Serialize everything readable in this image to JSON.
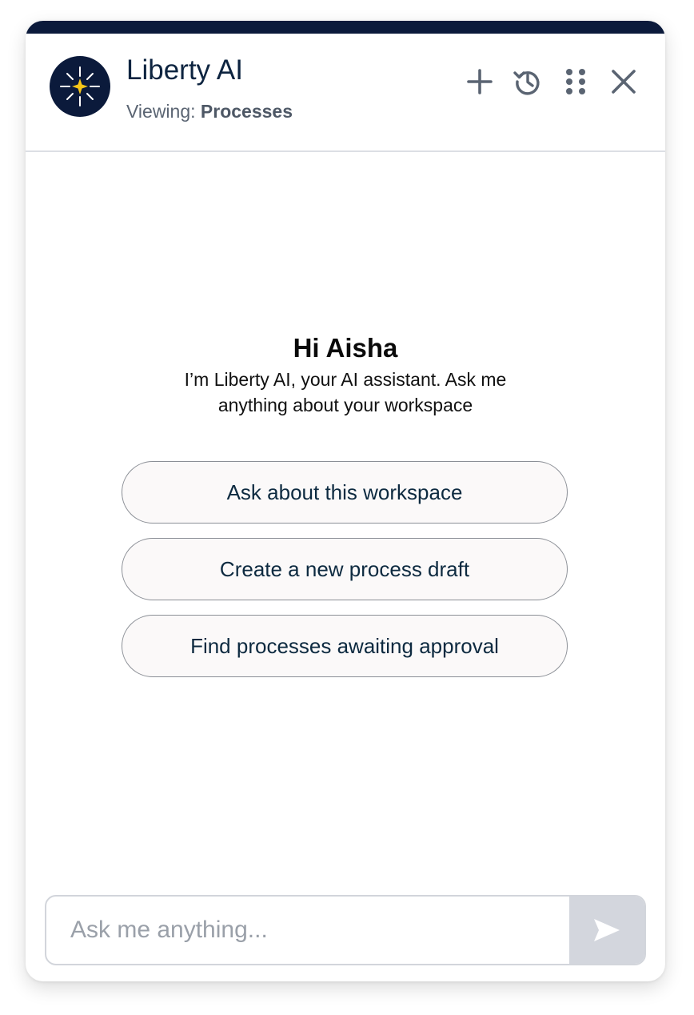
{
  "header": {
    "title": "Liberty AI",
    "viewing_prefix": "Viewing:",
    "viewing_value": "Processes",
    "icons": [
      "sparkle-logo-icon",
      "plus-icon",
      "history-icon",
      "grid-dots-icon",
      "close-icon"
    ]
  },
  "welcome": {
    "greeting": "Hi Aisha",
    "intro": "I’m Liberty AI, your AI assistant. Ask me anything about your workspace"
  },
  "suggestions": [
    {
      "label": "Ask about this workspace"
    },
    {
      "label": "Create a new process draft"
    },
    {
      "label": "Find processes awaiting approval"
    }
  ],
  "composer": {
    "placeholder": "Ask me anything...",
    "send_icon": "send-icon"
  },
  "colors": {
    "brand_navy": "#0b1a3b",
    "accent_gold": "#f5c518",
    "send_button_bg": "#d3d6dd"
  }
}
